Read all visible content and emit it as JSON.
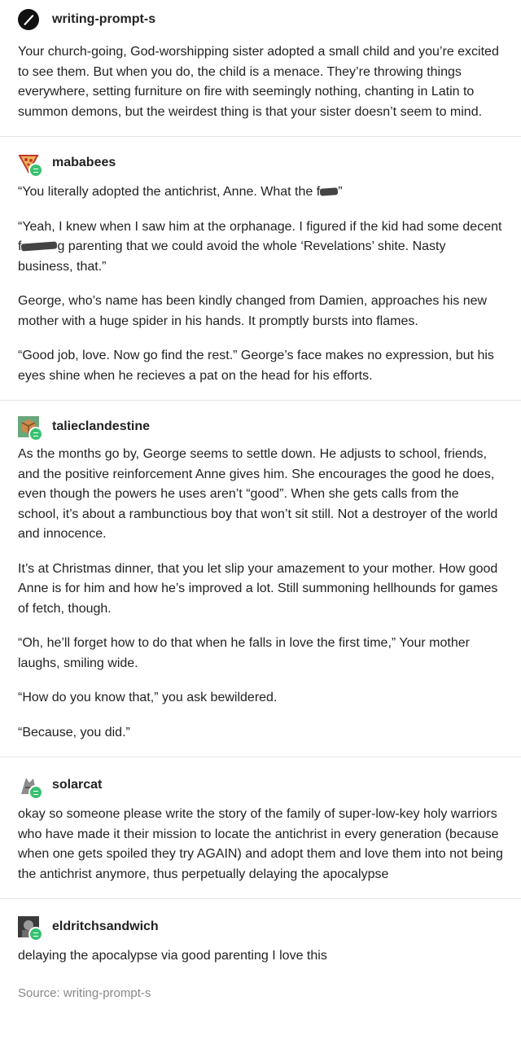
{
  "posts": [
    {
      "username": "writing-prompt-s",
      "avatar_icon": "feather-quill-icon",
      "paragraphs": [
        "Your church-going, God-worshipping sister adopted a small child and you’re excited to see them. But when you do, the child is a menace. They’re throwing things everywhere, setting furniture on fire with seemingly nothing, chanting in Latin to summon demons, but the weirdest thing is that your sister doesn’t seem to mind."
      ]
    },
    {
      "username": "mababees",
      "avatar_icon": "pizza-slice-icon",
      "p1_a": "“You literally adopted the antichrist, Anne. What the f",
      "p1_b": "”",
      "p2_a": "“Yeah, I knew when I saw him at the orphanage. I figured if the kid had some decent f",
      "p2_b": "g parenting that we could avoid the whole ‘Revelations’ shite. Nasty business, that.”",
      "paragraphs": [
        "George, who’s name has been kindly changed from Damien, approaches his new mother with a huge spider in his hands. It promptly bursts into flames.",
        "“Good job, love. Now go find the rest.” George’s face makes no expression, but his eyes shine when he recieves a pat on the head for his efforts."
      ]
    },
    {
      "username": "talieclandestine",
      "avatar_icon": "cube-icon",
      "paragraphs": [
        "As the months go by, George seems to settle down. He adjusts to school, friends, and the positive reinforcement Anne gives him. She encourages the good he does, even though the powers he uses aren’t “good”. When she gets calls from the school, it’s about a rambunctious boy that won’t sit still. Not a destroyer of the world and innocence.",
        "It’s at Christmas dinner, that you let slip your amazement to your mother. How good Anne is for him and how he’s improved a lot. Still summoning hellhounds for games of fetch, though.",
        "“Oh, he’ll forget how to do that when he falls in love the first time,” Your mother laughs, smiling wide.",
        "“How do you know that,” you ask bewildered.",
        "“Because, you did.”"
      ]
    },
    {
      "username": "solarcat",
      "avatar_icon": "cat-icon",
      "paragraphs": [
        "okay so someone please write the story of the family of super-low-key holy warriors who have made it their mission to locate the antichrist in every generation (because when one gets spoiled they try AGAIN) and adopt them and love them into not being the antichrist anymore, thus perpetually delaying the apocalypse"
      ]
    },
    {
      "username": "eldritchsandwich",
      "avatar_icon": "photo-avatar-icon",
      "paragraphs": [
        "delaying the apocalypse via good parenting I love this"
      ]
    }
  ],
  "source": "Source: writing-prompt-s",
  "colors": {
    "badge": "#38c172",
    "divider": "#e4e4e4",
    "source": "#888888"
  }
}
